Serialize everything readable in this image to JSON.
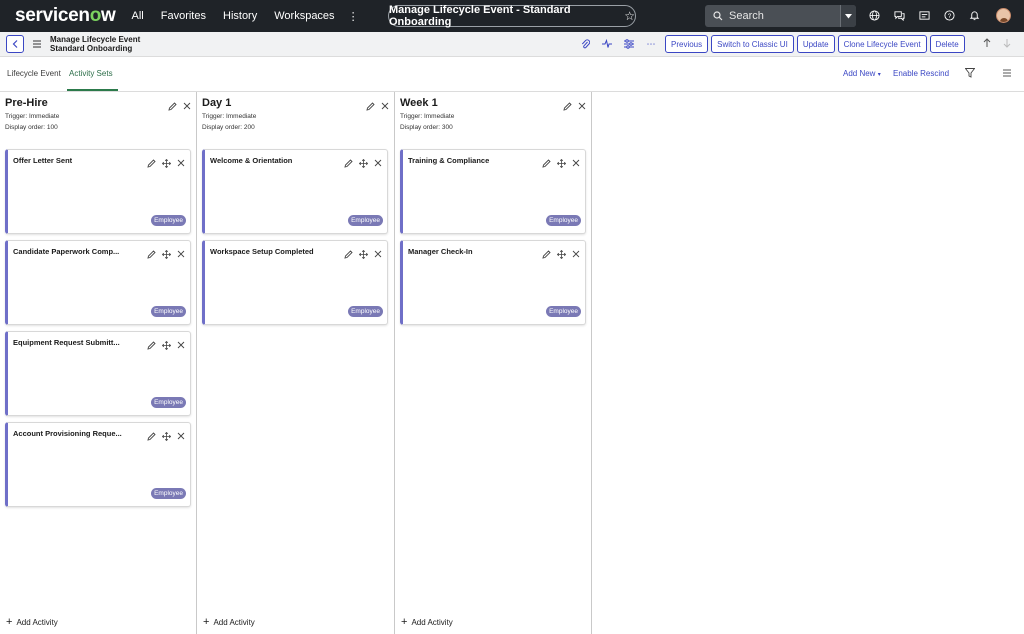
{
  "topnav": {
    "logo_text": "servicenow",
    "menu": [
      "All",
      "Favorites",
      "History",
      "Workspaces"
    ],
    "current_record_pill": "Manage Lifecycle Event - Standard Onboarding",
    "search_placeholder": "Search",
    "icons": [
      "globe-icon",
      "chat-icon",
      "inbox-icon",
      "help-icon",
      "bell-icon",
      "avatar"
    ]
  },
  "record_header": {
    "title_line1": "Manage Lifecycle Event",
    "title_line2": "Standard Onboarding",
    "icons": [
      "paperclip-icon",
      "activity-icon",
      "settings-sliders-icon",
      "more-icon"
    ],
    "buttons": [
      "Previous",
      "Switch to Classic UI",
      "Update",
      "Clone Lifecycle Event",
      "Delete"
    ]
  },
  "tabs": {
    "items": [
      "Lifecycle Event",
      "Activity Sets"
    ],
    "active": "Activity Sets",
    "add_new": "Add New",
    "enable_rescind": "Enable Rescind"
  },
  "columns": [
    {
      "title": "Pre-Hire",
      "trigger": "Trigger: Immediate",
      "display_order": "Display order: 100",
      "cards": [
        {
          "title": "Offer Letter Sent",
          "badge": "Employee"
        },
        {
          "title": "Candidate Paperwork Comp...",
          "badge": "Employee"
        },
        {
          "title": "Equipment Request Submitt...",
          "badge": "Employee"
        },
        {
          "title": "Account Provisioning Reque...",
          "badge": "Employee"
        }
      ],
      "add_label": "Add Activity"
    },
    {
      "title": "Day 1",
      "trigger": "Trigger: Immediate",
      "display_order": "Display order: 200",
      "cards": [
        {
          "title": "Welcome & Orientation",
          "badge": "Employee"
        },
        {
          "title": "Workspace Setup Completed",
          "badge": "Employee"
        }
      ],
      "add_label": "Add Activity"
    },
    {
      "title": "Week 1",
      "trigger": "Trigger: Immediate",
      "display_order": "Display order: 300",
      "cards": [
        {
          "title": "Training & Compliance",
          "badge": "Employee"
        },
        {
          "title": "Manager Check-In",
          "badge": "Employee"
        }
      ],
      "add_label": "Add Activity"
    }
  ],
  "colors": {
    "topbar": "#1f2328",
    "accent_blue": "#3b47c4",
    "active_tab_green": "#2c7a4b",
    "card_stripe": "#6f6fc8",
    "badge": "#7a79b5"
  }
}
